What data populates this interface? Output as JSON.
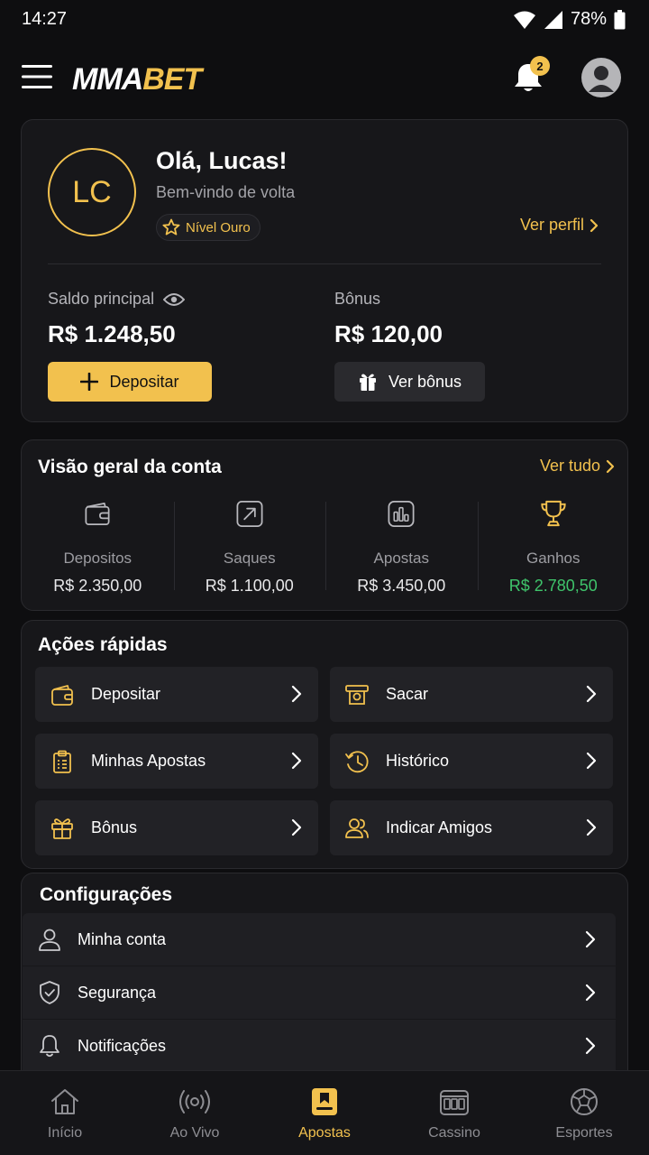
{
  "status_bar": {
    "time": "14:27",
    "battery": "78%"
  },
  "header": {
    "logo_part1": "MMA",
    "logo_part2": "BET",
    "notification_count": "2"
  },
  "profile": {
    "initials": "LC",
    "greeting": "Olá, Lucas!",
    "welcome": "Bem-vindo de volta",
    "level": "Nível Ouro",
    "view_profile": "Ver perfil",
    "main_balance_label": "Saldo principal",
    "main_balance": "R$ 1.248,50",
    "bonus_label": "Bônus",
    "bonus_balance": "R$ 120,00",
    "deposit_button": "Depositar",
    "view_bonus_button": "Ver bônus"
  },
  "overview": {
    "title": "Visão geral da conta",
    "see_all": "Ver tudo",
    "stats": [
      {
        "label": "Depositos",
        "value": "R$ 2.350,00",
        "icon": "wallet-icon"
      },
      {
        "label": "Saques",
        "value": "R$ 1.100,00",
        "icon": "withdraw-arrow-icon"
      },
      {
        "label": "Apostas",
        "value": "R$ 3.450,00",
        "icon": "bar-chart-icon"
      },
      {
        "label": "Ganhos",
        "value": "R$ 2.780,50",
        "icon": "trophy-icon"
      }
    ]
  },
  "quick_actions": {
    "title": "Ações rápidas",
    "items": [
      {
        "label": "Depositar",
        "icon": "wallet-icon"
      },
      {
        "label": "Sacar",
        "icon": "cash-out-icon"
      },
      {
        "label": "Minhas Apostas",
        "icon": "clipboard-icon"
      },
      {
        "label": "Histórico",
        "icon": "history-icon"
      },
      {
        "label": "Bônus",
        "icon": "gift-icon"
      },
      {
        "label": "Indicar Amigos",
        "icon": "users-icon"
      }
    ]
  },
  "settings": {
    "title": "Configurações",
    "items": [
      {
        "label": "Minha conta",
        "icon": "user-icon"
      },
      {
        "label": "Segurança",
        "icon": "shield-icon"
      },
      {
        "label": "Notificações",
        "icon": "bell-icon"
      }
    ]
  },
  "bottom_nav": {
    "items": [
      {
        "label": "Início",
        "icon": "home-icon"
      },
      {
        "label": "Ao Vivo",
        "icon": "live-icon"
      },
      {
        "label": "Apostas",
        "icon": "bets-icon",
        "active": true
      },
      {
        "label": "Cassino",
        "icon": "slot-machine-icon"
      },
      {
        "label": "Esportes",
        "icon": "soccer-ball-icon"
      }
    ]
  },
  "colors": {
    "background": "#0e0e10",
    "card": "#17171a",
    "accent": "#f2c14e",
    "positive": "#3fc46b",
    "muted_text": "#a3a3a8"
  }
}
